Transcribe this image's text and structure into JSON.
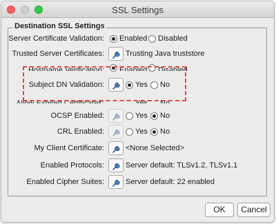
{
  "window": {
    "title": "SSL Settings"
  },
  "group": {
    "title": "Destination SSL Settings"
  },
  "rows": {
    "server_cert_validation": {
      "label": "Server Certificate Validation:",
      "opt1": "Enabled",
      "opt2": "Disabled",
      "selected": "Enabled"
    },
    "trusted_server_certs": {
      "label": "Trusted Server Certificates:",
      "value": "Trusting Java truststore"
    },
    "hostname_verification": {
      "label": "Hostname Verification:",
      "opt1": "Enabled",
      "opt2": "Disabled"
    },
    "subject_dn_validation": {
      "label": "Subject DN Validation:",
      "opt1": "Yes",
      "opt2": "No",
      "selected": "Yes"
    },
    "allow_expired": {
      "label": "Allow Expired Certificates:",
      "opt1": "Yes",
      "opt2": "No"
    },
    "ocsp": {
      "label": "OCSP Enabled:",
      "opt1": "Yes",
      "opt2": "No",
      "selected": "No"
    },
    "crl": {
      "label": "CRL Enabled:",
      "opt1": "Yes",
      "opt2": "No",
      "selected": "No"
    },
    "client_cert": {
      "label": "My Client Certificate:",
      "value": "<None Selected>"
    },
    "protocols": {
      "label": "Enabled Protocols:",
      "value": "Server default: TLSv1.2, TLSv1.1"
    },
    "cipher_suites": {
      "label": "Enabled Cipher Suites:",
      "value": "Server default: 22 enabled"
    }
  },
  "buttons": {
    "ok": "OK",
    "cancel": "Cancel"
  },
  "colors": {
    "highlight": "#e8493d",
    "close": "#fc615d",
    "maximize": "#35c84a"
  }
}
